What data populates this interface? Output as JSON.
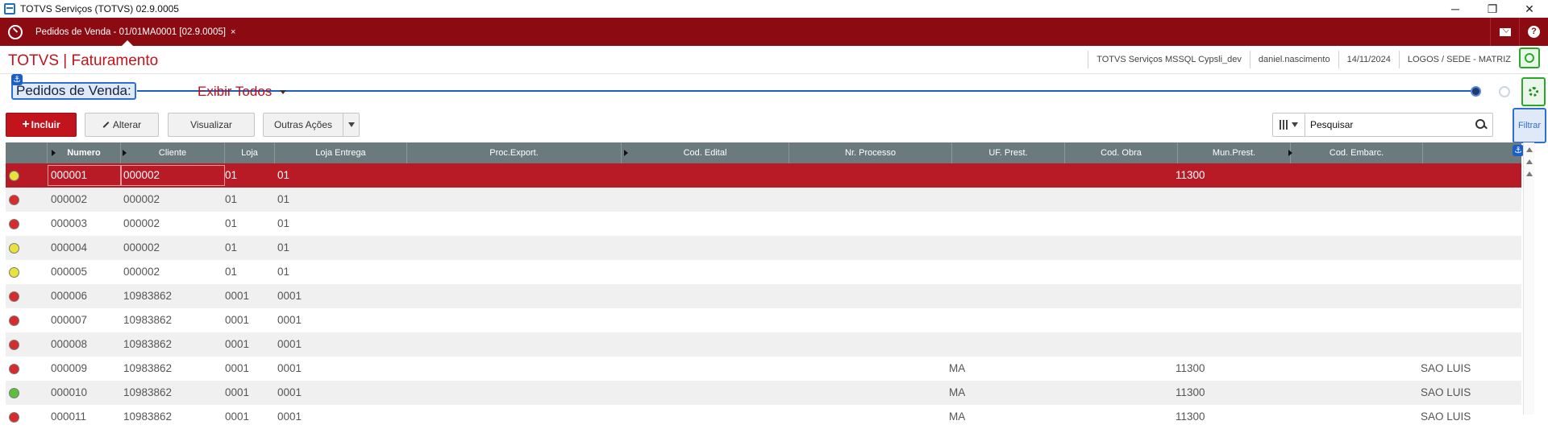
{
  "window": {
    "title": "TOTVS Serviços (TOTVS) 02.9.0005",
    "minimize": "─",
    "restore": "❐",
    "close": "✕"
  },
  "tabbar": {
    "active_tab": "Pedidos de Venda - 01/01MA0001 [02.9.0005]",
    "tab_close": "×",
    "help": "?"
  },
  "header": {
    "app_title": "TOTVS | Faturamento",
    "environment": "TOTVS Serviços MSSQL Cypsli_dev",
    "user": "daniel.nascimento",
    "date": "14/11/2024",
    "branch": "LOGOS / SEDE - MATRIZ"
  },
  "view": {
    "title": "Pedidos de Venda:",
    "filter_option": "Exibir Todos"
  },
  "toolbar": {
    "include": "Incluir",
    "alter": "Alterar",
    "view": "Visualizar",
    "other_actions": "Outras Ações",
    "search_placeholder": "Pesquisar",
    "filter": "Filtrar"
  },
  "colors": {
    "brand_red": "#c1141d",
    "dark_red": "#8c0b13",
    "header_gray": "#6b7b7d",
    "status_red": "#d62c2c",
    "status_yellow": "#e8e23a",
    "status_green": "#5cbf3a"
  },
  "grid": {
    "columns": [
      "",
      "Numero",
      "Cliente",
      "Loja",
      "Loja Entrega",
      "Proc.Export.",
      "Cod. Edital",
      "Nr. Processo",
      "UF. Prest.",
      "Cod. Obra",
      "Mun.Prest.",
      "Cod. Embarc.",
      ""
    ],
    "rows": [
      {
        "status": "yellow",
        "numero": "000001",
        "cliente": "000002",
        "loja": "01",
        "loja_entrega": "01",
        "uf": "",
        "cod_obra": "11300",
        "mun": ""
      },
      {
        "status": "red",
        "numero": "000002",
        "cliente": "000002",
        "loja": "01",
        "loja_entrega": "01",
        "uf": "",
        "cod_obra": "",
        "mun": ""
      },
      {
        "status": "red",
        "numero": "000003",
        "cliente": "000002",
        "loja": "01",
        "loja_entrega": "01",
        "uf": "",
        "cod_obra": "",
        "mun": ""
      },
      {
        "status": "yellow",
        "numero": "000004",
        "cliente": "000002",
        "loja": "01",
        "loja_entrega": "01",
        "uf": "",
        "cod_obra": "",
        "mun": ""
      },
      {
        "status": "yellow",
        "numero": "000005",
        "cliente": "000002",
        "loja": "01",
        "loja_entrega": "01",
        "uf": "",
        "cod_obra": "",
        "mun": ""
      },
      {
        "status": "red",
        "numero": "000006",
        "cliente": "10983862",
        "loja": "0001",
        "loja_entrega": "0001",
        "uf": "",
        "cod_obra": "",
        "mun": ""
      },
      {
        "status": "red",
        "numero": "000007",
        "cliente": "10983862",
        "loja": "0001",
        "loja_entrega": "0001",
        "uf": "",
        "cod_obra": "",
        "mun": ""
      },
      {
        "status": "red",
        "numero": "000008",
        "cliente": "10983862",
        "loja": "0001",
        "loja_entrega": "0001",
        "uf": "",
        "cod_obra": "",
        "mun": ""
      },
      {
        "status": "red",
        "numero": "000009",
        "cliente": "10983862",
        "loja": "0001",
        "loja_entrega": "0001",
        "uf": "MA",
        "cod_obra": "11300",
        "mun": "SAO LUIS"
      },
      {
        "status": "green",
        "numero": "000010",
        "cliente": "10983862",
        "loja": "0001",
        "loja_entrega": "0001",
        "uf": "MA",
        "cod_obra": "11300",
        "mun": "SAO LUIS"
      },
      {
        "status": "red",
        "numero": "000011",
        "cliente": "10983862",
        "loja": "0001",
        "loja_entrega": "0001",
        "uf": "MA",
        "cod_obra": "11300",
        "mun": "SAO LUIS"
      }
    ]
  }
}
